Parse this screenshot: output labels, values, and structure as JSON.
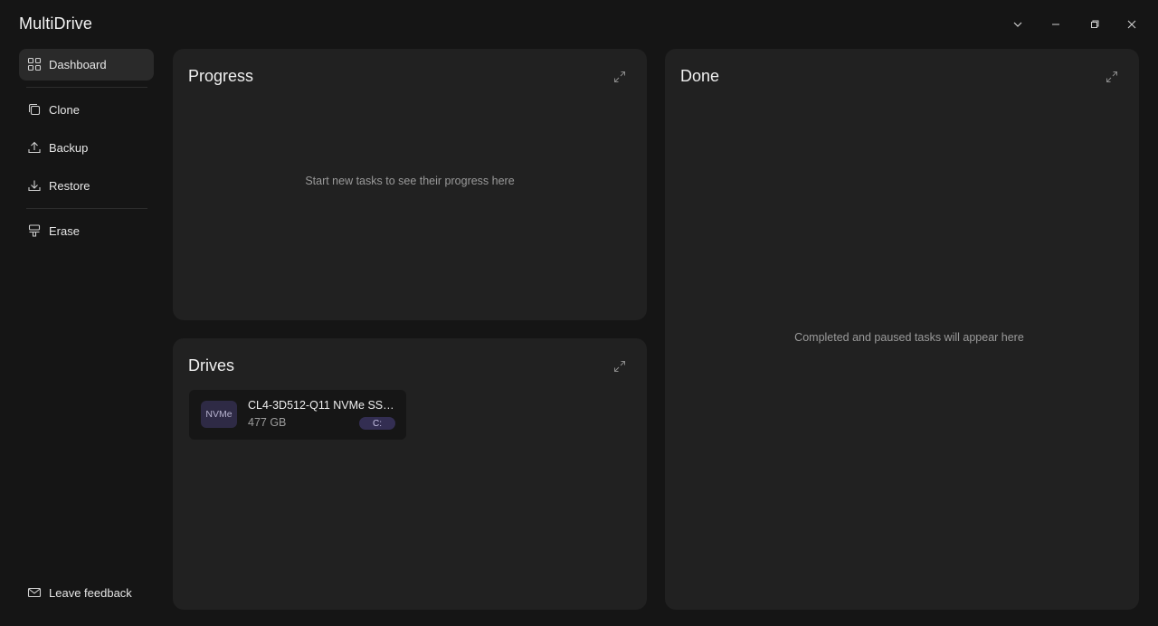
{
  "app": {
    "title": "MultiDrive"
  },
  "window_controls": {
    "chevron_icon": "chevron-down-icon",
    "minimize_icon": "minimize-icon",
    "restore_icon": "restore-icon",
    "close_icon": "close-icon"
  },
  "sidebar": {
    "items": [
      {
        "label": "Dashboard",
        "icon": "grid-icon",
        "active": true
      },
      {
        "label": "Clone",
        "icon": "copy-icon",
        "active": false
      },
      {
        "label": "Backup",
        "icon": "upload-icon",
        "active": false
      },
      {
        "label": "Restore",
        "icon": "download-icon",
        "active": false
      },
      {
        "label": "Erase",
        "icon": "eraser-icon",
        "active": false
      }
    ],
    "feedback": {
      "label": "Leave feedback",
      "icon": "mail-icon"
    }
  },
  "panels": {
    "progress": {
      "title": "Progress",
      "empty_message": "Start new tasks to see their progress here"
    },
    "drives": {
      "title": "Drives",
      "items": [
        {
          "type": "NVMe",
          "name": "CL4-3D512-Q11 NVMe SSSTC...",
          "size": "477 GB",
          "letter": "C:"
        }
      ]
    },
    "done": {
      "title": "Done",
      "empty_message": "Completed and paused tasks will appear here"
    }
  },
  "colors": {
    "background": "#151515",
    "panel": "#212121",
    "active_nav": "#2a2a2a",
    "accent_badge": "#2e2a45"
  }
}
